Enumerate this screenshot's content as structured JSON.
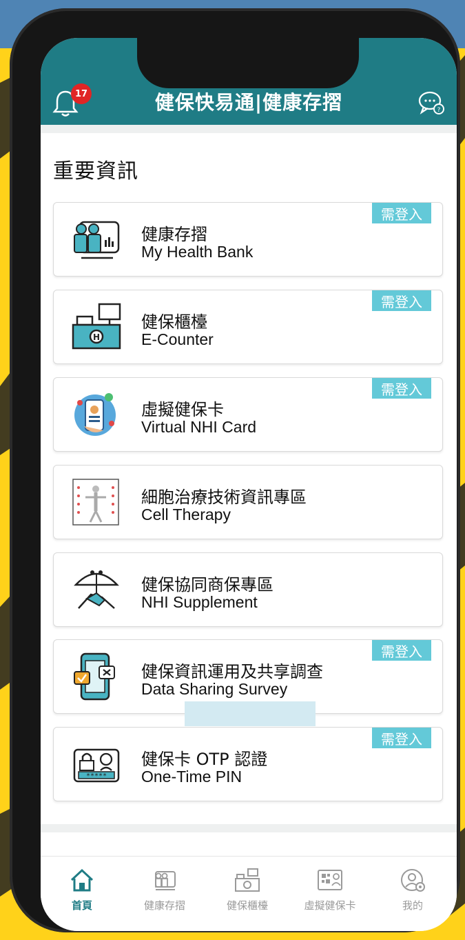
{
  "header": {
    "title": "健保快易通|健康存摺",
    "notification_count": "17",
    "bell_icon": "bell-icon",
    "chat_icon": "chat-help-icon"
  },
  "section": {
    "title": "重要資訊"
  },
  "login_tag": "需登入",
  "cards": [
    {
      "zh": "健康存摺",
      "en": "My Health Bank",
      "icon": "health-bank-icon",
      "needs_login": true
    },
    {
      "zh": "健保櫃檯",
      "en": "E-Counter",
      "icon": "counter-icon",
      "needs_login": true
    },
    {
      "zh": "虛擬健保卡",
      "en": "Virtual NHI Card",
      "icon": "virtual-card-icon",
      "needs_login": true
    },
    {
      "zh": "細胞治療技術資訊專區",
      "en": "Cell Therapy",
      "icon": "cell-therapy-icon",
      "needs_login": false
    },
    {
      "zh": "健保協同商保專區",
      "en": "NHI Supplement",
      "icon": "umbrella-handshake-icon",
      "needs_login": false
    },
    {
      "zh": "健保資訊運用及共享調查",
      "en": "Data Sharing Survey",
      "icon": "survey-phone-icon",
      "needs_login": true
    },
    {
      "zh": "健保卡 OTP 認證",
      "en": "One-Time PIN",
      "icon": "otp-lock-icon",
      "needs_login": true
    }
  ],
  "tabs": [
    {
      "label": "首頁",
      "icon": "home-icon",
      "active": true
    },
    {
      "label": "健康存摺",
      "icon": "health-bank-icon",
      "active": false
    },
    {
      "label": "健保櫃檯",
      "icon": "counter-icon",
      "active": false
    },
    {
      "label": "虛擬健保卡",
      "icon": "qr-card-icon",
      "active": false
    },
    {
      "label": "我的",
      "icon": "user-settings-icon",
      "active": false
    }
  ],
  "colors": {
    "primary": "#1f7c85",
    "tag": "#63c9d8",
    "badge": "#e02525",
    "background": "#ffd21a",
    "top_band": "#4f84b4"
  }
}
